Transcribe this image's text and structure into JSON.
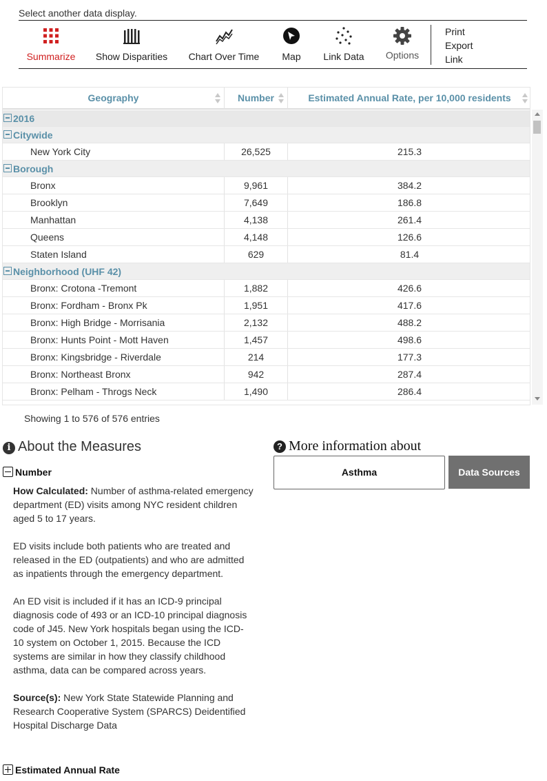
{
  "header": {
    "select_label": "Select another data display."
  },
  "toolbar": {
    "tools": [
      {
        "label": "Summarize",
        "icon": "grid-icon",
        "active": true
      },
      {
        "label": "Show Disparities",
        "icon": "bars-icon"
      },
      {
        "label": "Chart Over Time",
        "icon": "line-chart-icon"
      },
      {
        "label": "Map",
        "icon": "map-pointer-icon"
      },
      {
        "label": "Link Data",
        "icon": "scatter-icon"
      },
      {
        "label": "Options",
        "icon": "gear-icon"
      }
    ],
    "side_links": {
      "print": "Print",
      "export": "Export",
      "link": "Link"
    }
  },
  "table": {
    "columns": {
      "geography": "Geography",
      "number": "Number",
      "rate": "Estimated Annual Rate, per 10,000 residents"
    },
    "year_group": "2016",
    "groups": {
      "citywide": {
        "label": "Citywide",
        "rows": [
          {
            "geo": "New York City",
            "number": "26,525",
            "rate": "215.3"
          }
        ]
      },
      "borough": {
        "label": "Borough",
        "rows": [
          {
            "geo": "Bronx",
            "number": "9,961",
            "rate": "384.2"
          },
          {
            "geo": "Brooklyn",
            "number": "7,649",
            "rate": "186.8"
          },
          {
            "geo": "Manhattan",
            "number": "4,138",
            "rate": "261.4"
          },
          {
            "geo": "Queens",
            "number": "4,148",
            "rate": "126.6"
          },
          {
            "geo": "Staten Island",
            "number": "629",
            "rate": "81.4"
          }
        ]
      },
      "neighborhood": {
        "label": "Neighborhood (UHF 42)",
        "rows": [
          {
            "geo": "Bronx: Crotona -Tremont",
            "number": "1,882",
            "rate": "426.6"
          },
          {
            "geo": "Bronx: Fordham - Bronx Pk",
            "number": "1,951",
            "rate": "417.6"
          },
          {
            "geo": "Bronx: High Bridge - Morrisania",
            "number": "2,132",
            "rate": "488.2"
          },
          {
            "geo": "Bronx: Hunts Point - Mott Haven",
            "number": "1,457",
            "rate": "498.6"
          },
          {
            "geo": "Bronx: Kingsbridge - Riverdale",
            "number": "214",
            "rate": "177.3"
          },
          {
            "geo": "Bronx: Northeast Bronx",
            "number": "942",
            "rate": "287.4"
          },
          {
            "geo": "Bronx: Pelham - Throgs Neck",
            "number": "1,490",
            "rate": "286.4"
          }
        ]
      }
    },
    "showing": "Showing 1 to 576 of 576 entries"
  },
  "about": {
    "title": "About the Measures",
    "number_section": {
      "heading": "Number",
      "how_label": "How Calculated:",
      "how_text": "Number of asthma-related emergency department (ED) visits among NYC resident children aged 5 to 17 years.",
      "para2": "ED visits include both patients who are treated and released in the ED (outpatients) and who are admitted as inpatients through the emergency department.",
      "para3": "An ED visit is included if it has an ICD-9 principal diagnosis code of 493 or an ICD-10 principal diagnosis code of J45. New York hospitals began using the ICD-10 system on October 1, 2015. Because the ICD systems are similar in how they classify childhood asthma, data can be compared across years.",
      "source_label": "Source(s):",
      "source_text": "New York State Statewide Planning and Research Cooperative System (SPARCS) Deidentified Hospital Discharge Data"
    },
    "rate_section": {
      "heading": "Estimated Annual Rate"
    }
  },
  "more_info": {
    "title": "More information about",
    "asthma_button": "Asthma",
    "sources_button": "Data Sources"
  },
  "colors": {
    "accent_red": "#d02020",
    "header_blue": "#5a90a8",
    "button_gray": "#707070"
  }
}
